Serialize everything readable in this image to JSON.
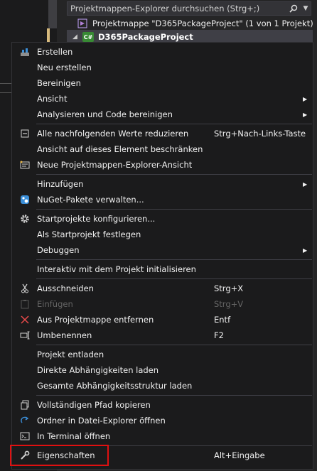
{
  "solution_explorer": {
    "search_placeholder": "Projektmappen-Explorer durchsuchen (Strg+;)",
    "solution_label": "Projektmappe \"D365PackageProject\" (1 von 1 Projekt)",
    "project_label": "D365PackageProject",
    "project_badge": "C#"
  },
  "context_menu": {
    "items": [
      {
        "label": "Erstellen",
        "shortcut": "",
        "icon": "build-icon",
        "submenu": false,
        "enabled": true
      },
      {
        "label": "Neu erstellen",
        "shortcut": "",
        "icon": "",
        "submenu": false,
        "enabled": true
      },
      {
        "label": "Bereinigen",
        "shortcut": "",
        "icon": "",
        "submenu": false,
        "enabled": true
      },
      {
        "label": "Ansicht",
        "shortcut": "",
        "icon": "",
        "submenu": true,
        "enabled": true
      },
      {
        "label": "Analysieren und Code bereinigen",
        "shortcut": "",
        "icon": "",
        "submenu": true,
        "enabled": true
      },
      {
        "label": "Alle nachfolgenden Werte reduzieren",
        "shortcut": "Strg+Nach-Links-Taste",
        "icon": "collapse-icon",
        "submenu": false,
        "enabled": true
      },
      {
        "label": "Ansicht auf dieses Element beschränken",
        "shortcut": "",
        "icon": "",
        "submenu": false,
        "enabled": true
      },
      {
        "label": "Neue Projektmappen-Explorer-Ansicht",
        "shortcut": "",
        "icon": "new-view-icon",
        "submenu": false,
        "enabled": true
      },
      {
        "label": "Hinzufügen",
        "shortcut": "",
        "icon": "",
        "submenu": true,
        "enabled": true
      },
      {
        "label": "NuGet-Pakete verwalten...",
        "shortcut": "",
        "icon": "nuget-icon",
        "submenu": false,
        "enabled": true
      },
      {
        "label": "Startprojekte konfigurieren...",
        "shortcut": "",
        "icon": "gear-icon",
        "submenu": false,
        "enabled": true
      },
      {
        "label": "Als Startprojekt festlegen",
        "shortcut": "",
        "icon": "",
        "submenu": false,
        "enabled": true
      },
      {
        "label": "Debuggen",
        "shortcut": "",
        "icon": "",
        "submenu": true,
        "enabled": true
      },
      {
        "label": "Interaktiv mit dem Projekt initialisieren",
        "shortcut": "",
        "icon": "",
        "submenu": false,
        "enabled": true
      },
      {
        "label": "Ausschneiden",
        "shortcut": "Strg+X",
        "icon": "scissors-icon",
        "submenu": false,
        "enabled": true
      },
      {
        "label": "Einfügen",
        "shortcut": "Strg+V",
        "icon": "paste-icon",
        "submenu": false,
        "enabled": false
      },
      {
        "label": "Aus Projektmappe entfernen",
        "shortcut": "Entf",
        "icon": "remove-icon",
        "submenu": false,
        "enabled": true
      },
      {
        "label": "Umbenennen",
        "shortcut": "F2",
        "icon": "rename-icon",
        "submenu": false,
        "enabled": true
      },
      {
        "label": "Projekt entladen",
        "shortcut": "",
        "icon": "",
        "submenu": false,
        "enabled": true
      },
      {
        "label": "Direkte Abhängigkeiten laden",
        "shortcut": "",
        "icon": "",
        "submenu": false,
        "enabled": true
      },
      {
        "label": "Gesamte Abhängigkeitsstruktur laden",
        "shortcut": "",
        "icon": "",
        "submenu": false,
        "enabled": true
      },
      {
        "label": "Vollständigen Pfad kopieren",
        "shortcut": "",
        "icon": "copy-icon",
        "submenu": false,
        "enabled": true
      },
      {
        "label": "Ordner in Datei-Explorer öffnen",
        "shortcut": "",
        "icon": "open-folder-icon",
        "submenu": false,
        "enabled": true
      },
      {
        "label": "In Terminal öffnen",
        "shortcut": "",
        "icon": "terminal-icon",
        "submenu": false,
        "enabled": true
      },
      {
        "label": "Eigenschaften",
        "shortcut": "Alt+Eingabe",
        "icon": "wrench-icon",
        "submenu": false,
        "enabled": true
      }
    ]
  },
  "colors": {
    "menu_bg": "#1b1b1c",
    "highlight_box": "#e01010",
    "disabled_text": "#656565",
    "csharp_badge": "#388a34"
  }
}
